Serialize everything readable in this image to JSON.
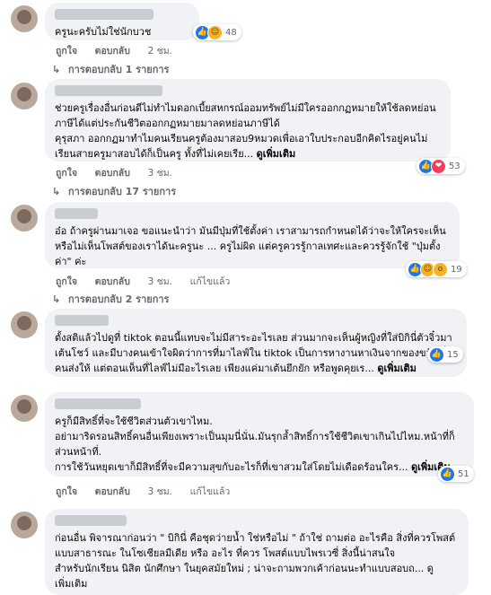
{
  "labels": {
    "like": "ถูกใจ",
    "reply": "ตอบกลับ",
    "edited": "แก้ไขแล้ว"
  },
  "see_more": "ดูเพิ่มเติม",
  "comments": [
    {
      "text": "ครูนะครับไม่ใช่นักบวช",
      "time": "2 ชม.",
      "reactions": [
        "like",
        "haha"
      ],
      "reaction_count": "48",
      "replies": "การตอบกลับ 1 รายการ",
      "edited": false
    },
    {
      "text": "ช่วยครูเรื่องอื่นก่อนดีไม่ทำไมดอกเบี้ยสหกรณ์ออมทรัพย์ไม่มีใครออกกฏหมายให้ใช้ลดหย่อนภาษีได้แต่ประกันชีวิตออกกฏหมายมาลดหย่อนภาษีได้\nคุรุสภา ออกกฏมาทำไมคนเรียนครูต้องมาสอบ9หมวดเพื่อเอาใบประกอบอีกคิดไรอยู่คนไม่เรียนสายครูมาสอบได้ก็เป็นครู ทั้งที่ไม่เคยเรีย...",
      "time": "3 ชม.",
      "reactions": [
        "like",
        "love"
      ],
      "reaction_count": "53",
      "replies": "การตอบกลับ 17 รายการ",
      "edited": false
    },
    {
      "text": "อ๋อ ถ้าครูผ่านมาเจอ ขอแนะนำว่า มันมีปุ่มที่ใช้ตั้งค่า เราสามารถกำหนดได้ว่าจะให้ใครจะเห็นหรือไม่เห็นโพสต์ของเราได้นะครูนะ ... ครูไม่ผิด แต่ครูควรรู้กาลเทศะและควรรู้จักใช้ \"ปุ่มตั้งค่า\" ค่ะ",
      "time": "3 ชม.",
      "reactions": [
        "like",
        "haha",
        "wow"
      ],
      "reaction_count": "19",
      "replies": "การตอบกลับ 2 รายการ",
      "edited": true
    },
    {
      "text": "ตั้งสติแล้วไปดูที่ tiktok ตอนนี้แทบจะไม่มีสาระอะไรเลย ส่วนมากจะเห็นผู้หญิงที่ใส่บิกินี่ตัวจิ๋วมาเต้นโชว์ และมีบางคนเข้าใจผิดว่าการที่มาไลฟ์ใน tiktok เป็นการหางานหาเงินจากของขวัญที่มีคนส่งให้ แต่ตอนเห็นที่ไลฟ์ไม่มีอะไรเลย เพียงแค่มาเต้นยึกยัก หรือพูดคุยเร...",
      "time": "",
      "reactions": [
        "like"
      ],
      "reaction_count": "15",
      "replies": "",
      "edited": false
    },
    {
      "text": "ครูก็มีสิทธิ์ที่จะใช้ชีวิตส่วนตัวเขาไหม.\nอย่ามาริดรอนสิทธิ์คนอื่นเพียงเพราะเป็นมุมนี่นั่น.มันรุกล้ำสิทธิ์การใช้ชีวิตเขาเกินไปไหม.หน้าที่ก็ส่วนหน้าที่.\nการใช้วันหยุดเขาก็มีสิทธิ์ที่จะมีความสุขกับอะไรก็ที่เขาสวมใส่โดยไม่เดือดร้อนใคร...",
      "time": "3 ชม.",
      "reactions": [
        "like"
      ],
      "reaction_count": "51",
      "replies": "",
      "edited": true
    },
    {
      "text": "ก่อนอื่น พิจารณาก่อนว่า \" บิกินี่ คือชุดว่ายน้ำ ใช่หรือไม่ \" ถ้าใช่ ถามต่อ อะไรคือ สิ่งที่ควรโพสต์แบบสาธารณะ ในโซเชียลมีเดีย หรือ อะไร ที่ควร โพสต์แบบไพรเวซี่ สิ่งนี้น่าสนใจ\nสำหรับนักเรียน นิสิต นักศึกษา ในยุคสมัยใหม่ ; น่าจะถามพวกเค้าก่อนนะทำแบบสอบถ... ดู\nเพิ่มเติม",
      "time": "",
      "reactions": [],
      "reaction_count": "",
      "replies": "",
      "edited": false
    }
  ]
}
